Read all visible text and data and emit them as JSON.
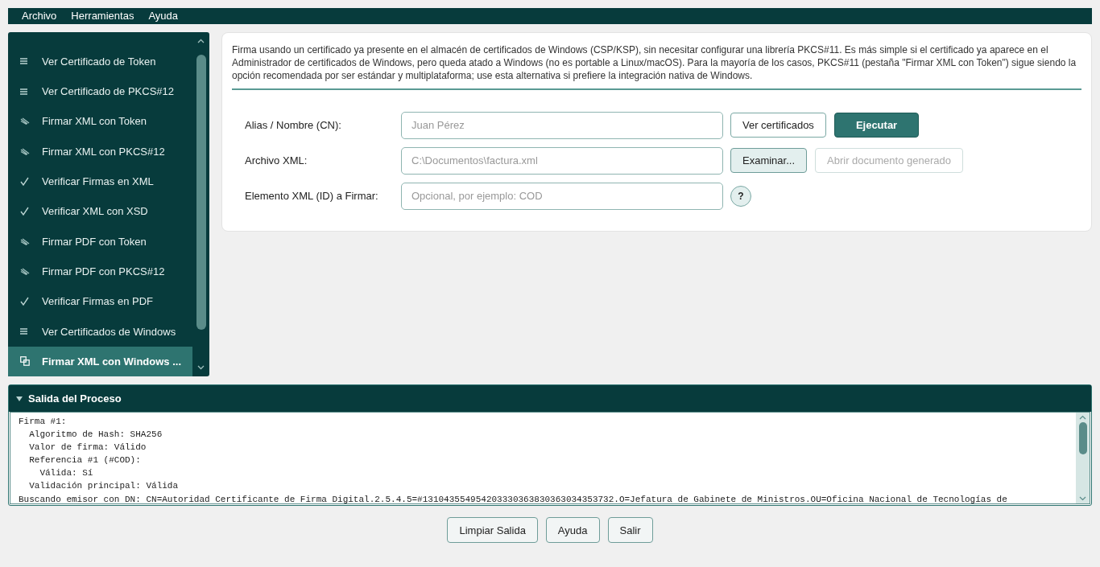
{
  "menu_bar": {
    "items": [
      "Archivo",
      "Herramientas",
      "Ayuda"
    ]
  },
  "sidebar": {
    "items": [
      {
        "kind": "list",
        "label": "Ver Certificado de Token",
        "selected": false
      },
      {
        "kind": "list",
        "label": "Ver Certificado de PKCS#12",
        "selected": false
      },
      {
        "kind": "sign",
        "label": "Firmar XML con Token",
        "selected": false
      },
      {
        "kind": "sign",
        "label": "Firmar XML con PKCS#12",
        "selected": false
      },
      {
        "kind": "check",
        "label": "Verificar Firmas en XML",
        "selected": false
      },
      {
        "kind": "check",
        "label": "Verificar XML con XSD",
        "selected": false
      },
      {
        "kind": "sign",
        "label": "Firmar PDF con Token",
        "selected": false
      },
      {
        "kind": "sign",
        "label": "Firmar PDF con PKCS#12",
        "selected": false
      },
      {
        "kind": "check",
        "label": "Verificar Firmas en PDF",
        "selected": false
      },
      {
        "kind": "list",
        "label": "Ver Certificados de Windows",
        "selected": false
      },
      {
        "kind": "windows",
        "label": "Firmar XML con Windows ...",
        "selected": true
      }
    ]
  },
  "description": "Firma usando un certificado ya presente en el almacén de certificados de Windows (CSP/KSP), sin necesitar configurar una librería PKCS#11. Es más simple si el certificado ya aparece en el Administrador de certificados de Windows, pero queda atado a Windows (no es portable a Linux/macOS). Para la mayoría de los casos, PKCS#11 (pestaña \"Firmar XML con Token\") sigue siendo la opción recomendada por ser estándar y multiplataforma; use esta alternativa si prefiere la integración nativa de Windows.",
  "form": [
    {
      "label": "Alias / Nombre (CN):",
      "placeholder": "Juan Pérez",
      "buttons": [
        {
          "kind": "outline",
          "label": "Ver certificados",
          "disabled": false
        },
        {
          "kind": "primary",
          "label": "Ejecutar",
          "disabled": false
        }
      ]
    },
    {
      "label": "Archivo XML:",
      "placeholder": "C:\\Documentos\\factura.xml",
      "buttons": [
        {
          "kind": "soft",
          "label": "Examinar...",
          "disabled": false
        },
        {
          "kind": "outline",
          "label": "Abrir documento generado",
          "disabled": true
        }
      ]
    },
    {
      "label": "Elemento XML (ID) a Firmar:",
      "placeholder": "Opcional, por ejemplo: COD",
      "buttons": [
        {
          "kind": "help",
          "label": "?",
          "disabled": false
        }
      ]
    }
  ],
  "output": {
    "title": "Salida del Proceso",
    "expanded": true,
    "lines": [
      "Firma #1:",
      "  Algoritmo de Hash: SHA256",
      "  Valor de firma: Válido",
      "  Referencia #1 (#COD):",
      "    Válida: Sí",
      "  Validación principal: Válida",
      "Buscando emisor con DN: CN=Autoridad Certificante de Firma Digital.2.5.4.5=#131043554954203330363830363034353732.O=Jefatura de Gabinete de Ministros.OU=Oficina Nacional de Tecnologías de"
    ]
  },
  "footer_buttons": [
    "Limpiar Salida",
    "Ayuda",
    "Salir"
  ]
}
